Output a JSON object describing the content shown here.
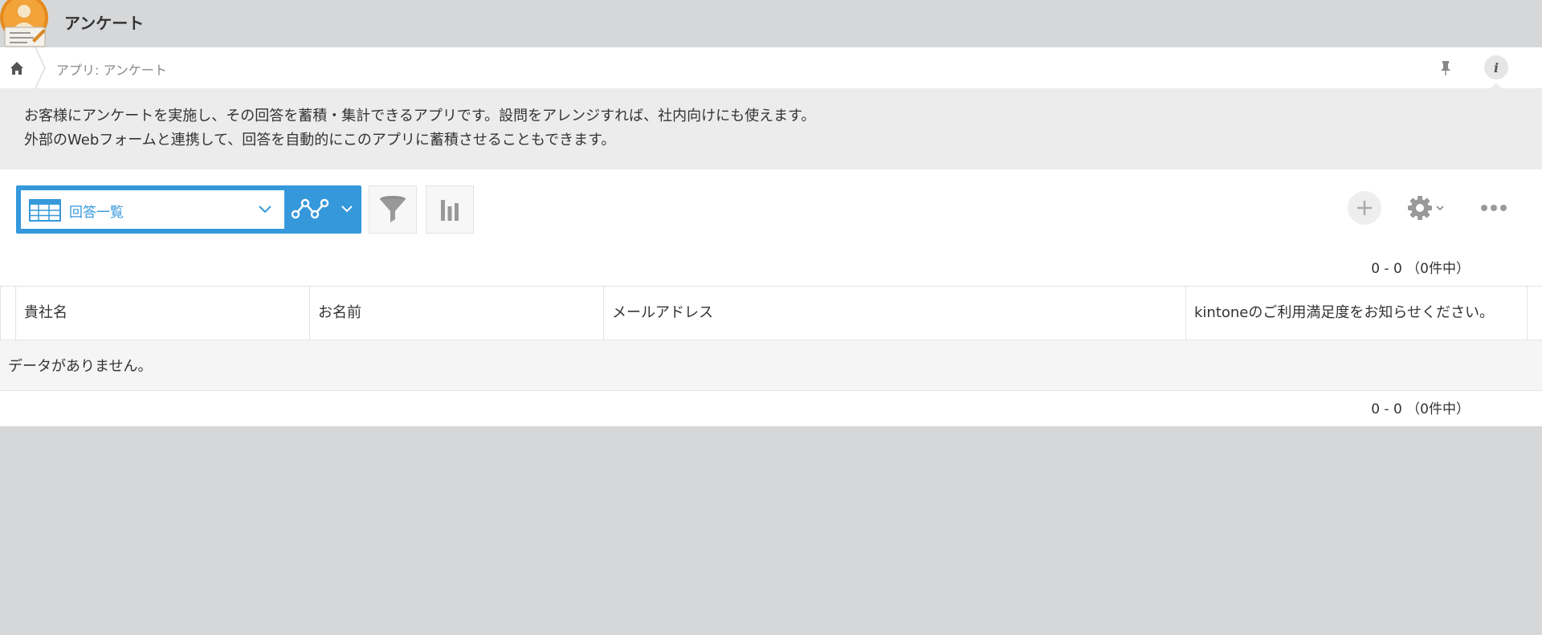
{
  "app": {
    "title": "アンケート"
  },
  "breadcrumb": {
    "current": "アプリ: アンケート"
  },
  "description": {
    "line1": "お客様にアンケートを実施し、その回答を蓄積・集計できるアプリです。設問をアレンジすれば、社内向けにも使えます。",
    "line2": "外部のWebフォームと連携して、回答を自動的にこのアプリに蓄積させることもできます。"
  },
  "toolbar": {
    "view_label": "回答一覧",
    "accent_color": "#3498db",
    "icons": [
      "table-view-icon",
      "chevron-down-icon",
      "graph-icon",
      "filter-icon",
      "bar-chart-icon",
      "plus-icon",
      "gear-icon",
      "more-icon"
    ]
  },
  "pagination": {
    "top": "0 - 0 （0件中）",
    "bottom": "0 - 0 （0件中）"
  },
  "table": {
    "columns": [
      "貴社名",
      "お名前",
      "メールアドレス",
      "kintoneのご利用満足度をお知らせください。"
    ],
    "empty_message": "データがありません。"
  }
}
